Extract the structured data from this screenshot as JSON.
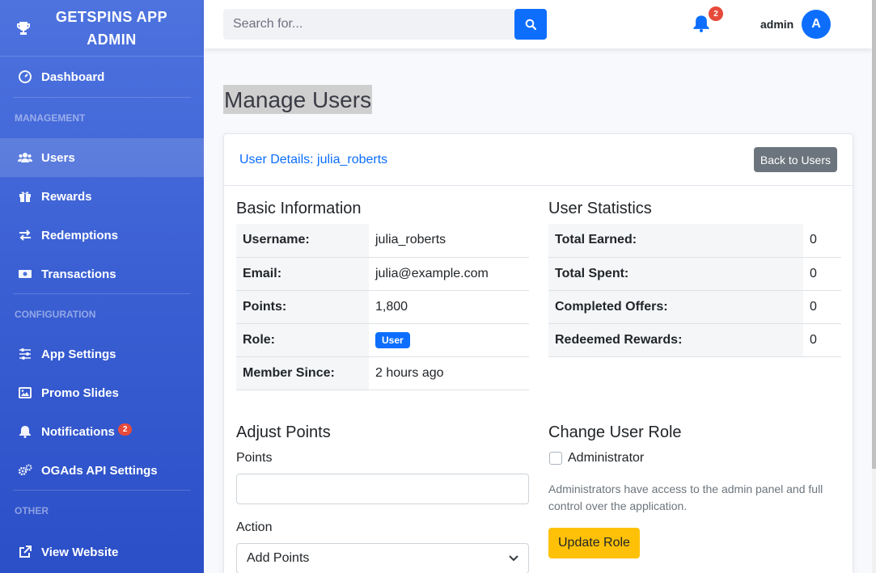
{
  "sidebar": {
    "brand_line1": "GETSPINS APP",
    "brand_line2": "ADMIN",
    "brand_icon": "trophy-icon",
    "dashboard": "Dashboard",
    "heading_management": "MANAGEMENT",
    "users": "Users",
    "rewards": "Rewards",
    "redemptions": "Redemptions",
    "transactions": "Transactions",
    "heading_configuration": "CONFIGURATION",
    "app_settings": "App Settings",
    "promo_slides": "Promo Slides",
    "notifications": "Notifications",
    "notifications_badge": "2",
    "ogads": "OGAds API Settings",
    "heading_other": "OTHER",
    "view_website": "View Website"
  },
  "topbar": {
    "search_placeholder": "Search for...",
    "bell_badge": "2",
    "username": "admin",
    "avatar_letter": "A"
  },
  "main": {
    "page_title": "Manage Users",
    "card_title": "User Details: julia_roberts",
    "back_button": "Back to Users",
    "basic_info": {
      "title": "Basic Information",
      "username_k": "Username:",
      "username_v": "julia_roberts",
      "email_k": "Email:",
      "email_v": "julia@example.com",
      "points_k": "Points:",
      "points_v": "1,800",
      "role_k": "Role:",
      "role_v": "User",
      "member_k": "Member Since:",
      "member_v": "2 hours ago"
    },
    "stats": {
      "title": "User Statistics",
      "earned_k": "Total Earned:",
      "earned_v": "0",
      "spent_k": "Total Spent:",
      "spent_v": "0",
      "offers_k": "Completed Offers:",
      "offers_v": "0",
      "redeemed_k": "Redeemed Rewards:",
      "redeemed_v": "0"
    },
    "adjust": {
      "title": "Adjust Points",
      "points_label": "Points",
      "points_value": "",
      "action_label": "Action",
      "action_value": "Add Points"
    },
    "role": {
      "title": "Change User Role",
      "admin_label": "Administrator",
      "admin_checked": false,
      "help": "Administrators have access to the admin panel and full control over the application.",
      "update_button": "Update Role"
    }
  },
  "colors": {
    "sidebar": "#4e73df",
    "primary": "#0d6efd",
    "danger": "#e74a3b",
    "warning": "#ffc107",
    "secondary": "#6c757d"
  }
}
